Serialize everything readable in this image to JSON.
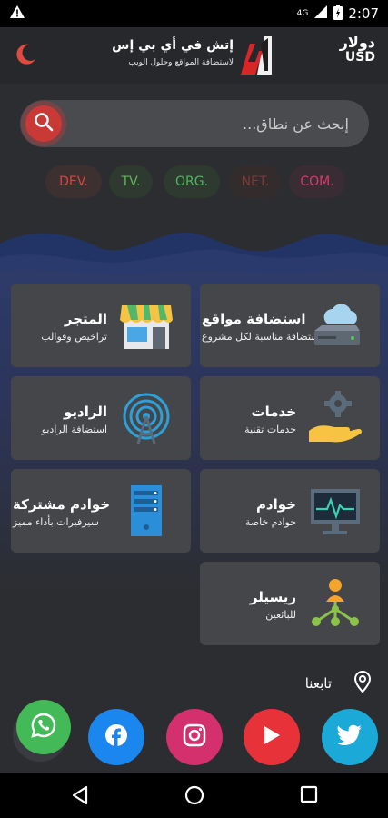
{
  "status_bar": {
    "time": "2:07",
    "network": "4G"
  },
  "header": {
    "logo_line1": "إتش في أي بي إس",
    "logo_line2": "لاستضافة المواقع وحلول الويب",
    "currency_ar": "دولار",
    "currency_en": "USD",
    "theme_icon": "moon-icon"
  },
  "search": {
    "placeholder": "إبحث عن نطاق...",
    "icon": "search-icon"
  },
  "tlds": [
    {
      "label": "COM.",
      "color": "#d83a6c"
    },
    {
      "label": "NET.",
      "color": "#7a3a3a"
    },
    {
      "label": "ORG.",
      "color": "#4bb85a"
    },
    {
      "label": "TV.",
      "color": "#62b657"
    },
    {
      "label": "DEV.",
      "color": "#d8453c"
    }
  ],
  "cards": [
    {
      "title": "استضافة مواقع",
      "subtitle": "استضافة مناسبة لكل مشروع",
      "icon": "cloud-server-icon"
    },
    {
      "title": "المتجر",
      "subtitle": "تراخيص وقوالب",
      "icon": "store-icon"
    },
    {
      "title": "خدمات",
      "subtitle": "خدمات تقنية",
      "icon": "gear-hand-icon"
    },
    {
      "title": "الراديو",
      "subtitle": "استضافة الراديو",
      "icon": "radio-tower-icon"
    },
    {
      "title": "خوادم",
      "subtitle": "خوادم خاصة",
      "icon": "monitor-icon"
    },
    {
      "title": "خوادم مشتركة",
      "subtitle": "سيرفيرات بأداء مميز",
      "icon": "server-rack-icon"
    },
    {
      "title": "ريسيلر",
      "subtitle": "للبائعين",
      "icon": "reseller-network-icon"
    }
  ],
  "follow": {
    "label": "تابعنا",
    "icon": "location-pin-icon"
  },
  "social": [
    {
      "name": "twitter",
      "color": "#1ba9d8"
    },
    {
      "name": "youtube",
      "color": "#e8323a"
    },
    {
      "name": "instagram",
      "color": "#d4306d"
    },
    {
      "name": "facebook",
      "color": "#1b86ed"
    },
    {
      "name": "whatsapp",
      "color": "#43b957"
    }
  ]
}
